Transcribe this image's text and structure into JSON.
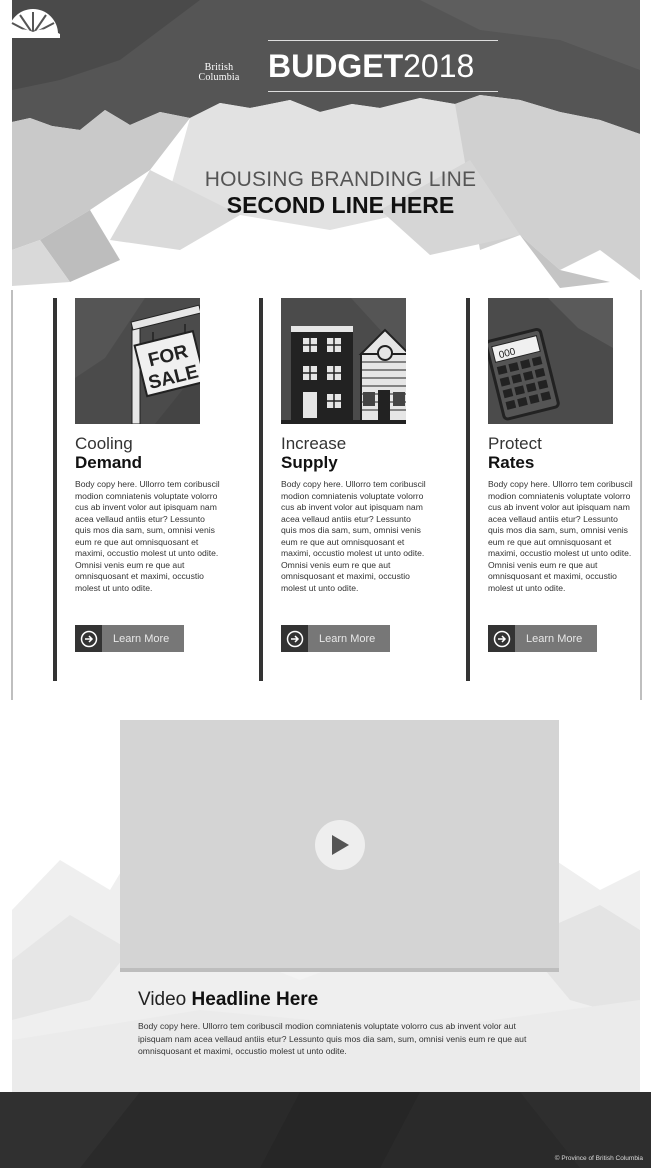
{
  "header": {
    "logo_line1": "British",
    "logo_line2": "Columbia",
    "budget_bold": "BUDGET",
    "budget_year": "2018"
  },
  "hero": {
    "line1": "HOUSING BRANDING LINE",
    "line2": "SECOND LINE HERE"
  },
  "cards": [
    {
      "title_light": "Cooling",
      "title_bold": "Demand",
      "icon": "for-sale-sign-icon",
      "sign_line1": "FOR",
      "sign_line2": "SALE",
      "body": "Body copy here. Ullorro tem coribuscil modion comniatenis voluptate volorro cus ab invent volor aut ipisquam nam acea vellaud antiis etur? Lessunto quis mos dia sam, sum, omnisi venis eum re que aut omnisquosant et maximi, occustio molest ut unto odite. Omnisi venis eum re que aut omnisquosant et maximi, occustio molest ut unto odite.",
      "button_label": "Learn More"
    },
    {
      "title_light": "Increase",
      "title_bold": "Supply",
      "icon": "buildings-icon",
      "body": "Body copy here. Ullorro tem coribuscil modion comniatenis voluptate volorro cus ab invent volor aut ipisquam nam acea vellaud antiis etur? Lessunto quis mos dia sam, sum, omnisi venis eum re que aut omnisquosant et maximi, occustio molest ut unto odite. Omnisi venis eum re que aut omnisquosant et maximi, occustio molest ut unto odite.",
      "button_label": "Learn More"
    },
    {
      "title_light": "Protect",
      "title_bold": "Rates",
      "icon": "calculator-icon",
      "calc_display": "000",
      "body": "Body copy here. Ullorro tem coribuscil modion comniatenis voluptate volorro cus ab invent volor aut ipisquam nam acea vellaud antiis etur? Lessunto quis mos dia sam, sum, omnisi venis eum re que aut omnisquosant et maximi, occustio molest ut unto odite. Omnisi venis eum re que aut omnisquosant et maximi, occustio molest ut unto odite.",
      "button_label": "Learn More"
    }
  ],
  "video": {
    "headline_light": "Video ",
    "headline_bold": "Headline Here",
    "body": "Body copy here. Ullorro tem coribuscil modion comniatenis voluptate volorro cus ab invent volor aut ipisquam nam acea vellaud antiis etur? Lessunto quis mos dia sam, sum, omnisi venis eum re que aut omnisquosant et maximi, occustio molest ut unto odite."
  },
  "footer": {
    "copyright": "© Province of British Columbia"
  },
  "colors": {
    "dark": "#333333",
    "button": "#777777",
    "video_placeholder": "#d4d4d4",
    "footer": "#2a2a2a"
  }
}
